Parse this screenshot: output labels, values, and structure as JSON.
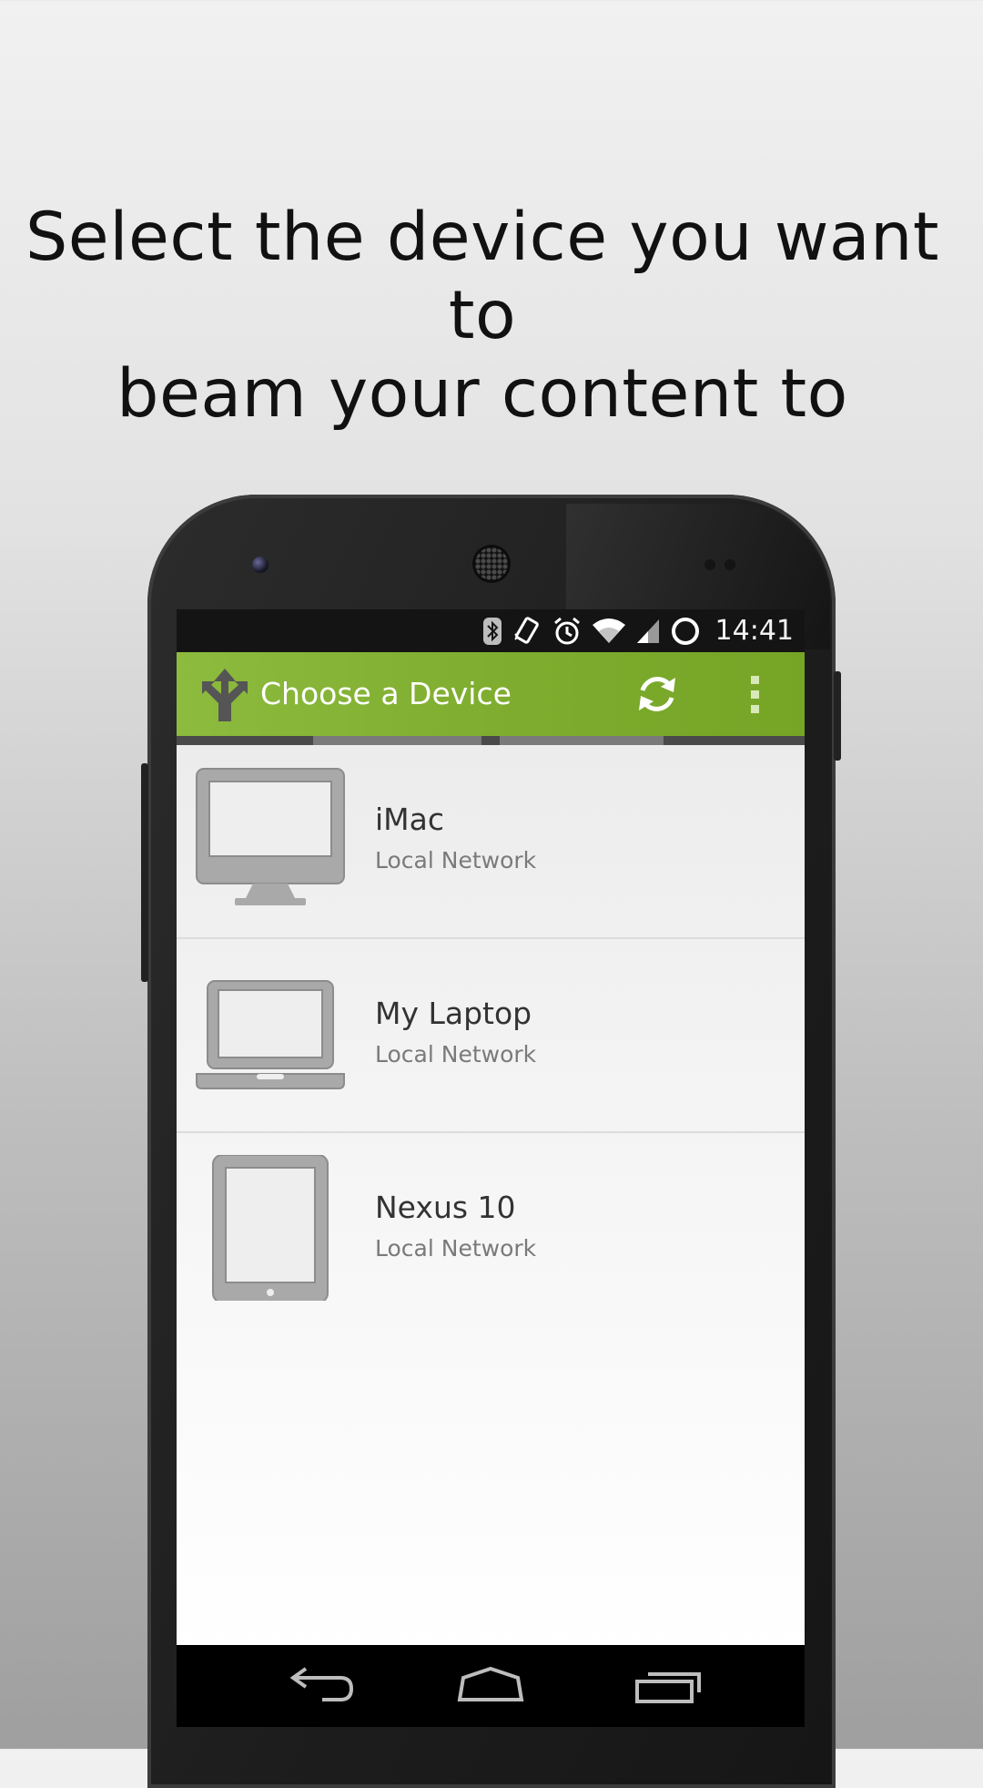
{
  "headline": {
    "line1": "Select the device you want to",
    "line2": "beam your content to"
  },
  "statusbar": {
    "icons": [
      "bluetooth-icon",
      "vibrate-icon",
      "alarm-icon",
      "wifi-icon",
      "signal-icon",
      "sync-circle-icon"
    ],
    "time": "14:41"
  },
  "actionbar": {
    "title": "Choose a Device",
    "app_icon": "split-arrows-icon",
    "actions": [
      "refresh-icon",
      "overflow-menu-icon"
    ],
    "color": "#7fad2f"
  },
  "devices": [
    {
      "name": "iMac",
      "network": "Local Network",
      "icon": "desktop-monitor-icon"
    },
    {
      "name": "My Laptop",
      "network": "Local Network",
      "icon": "laptop-icon"
    },
    {
      "name": "Nexus 10",
      "network": "Local Network",
      "icon": "tablet-icon"
    }
  ],
  "navbar": {
    "buttons": [
      "back-icon",
      "home-icon",
      "recents-icon"
    ]
  }
}
